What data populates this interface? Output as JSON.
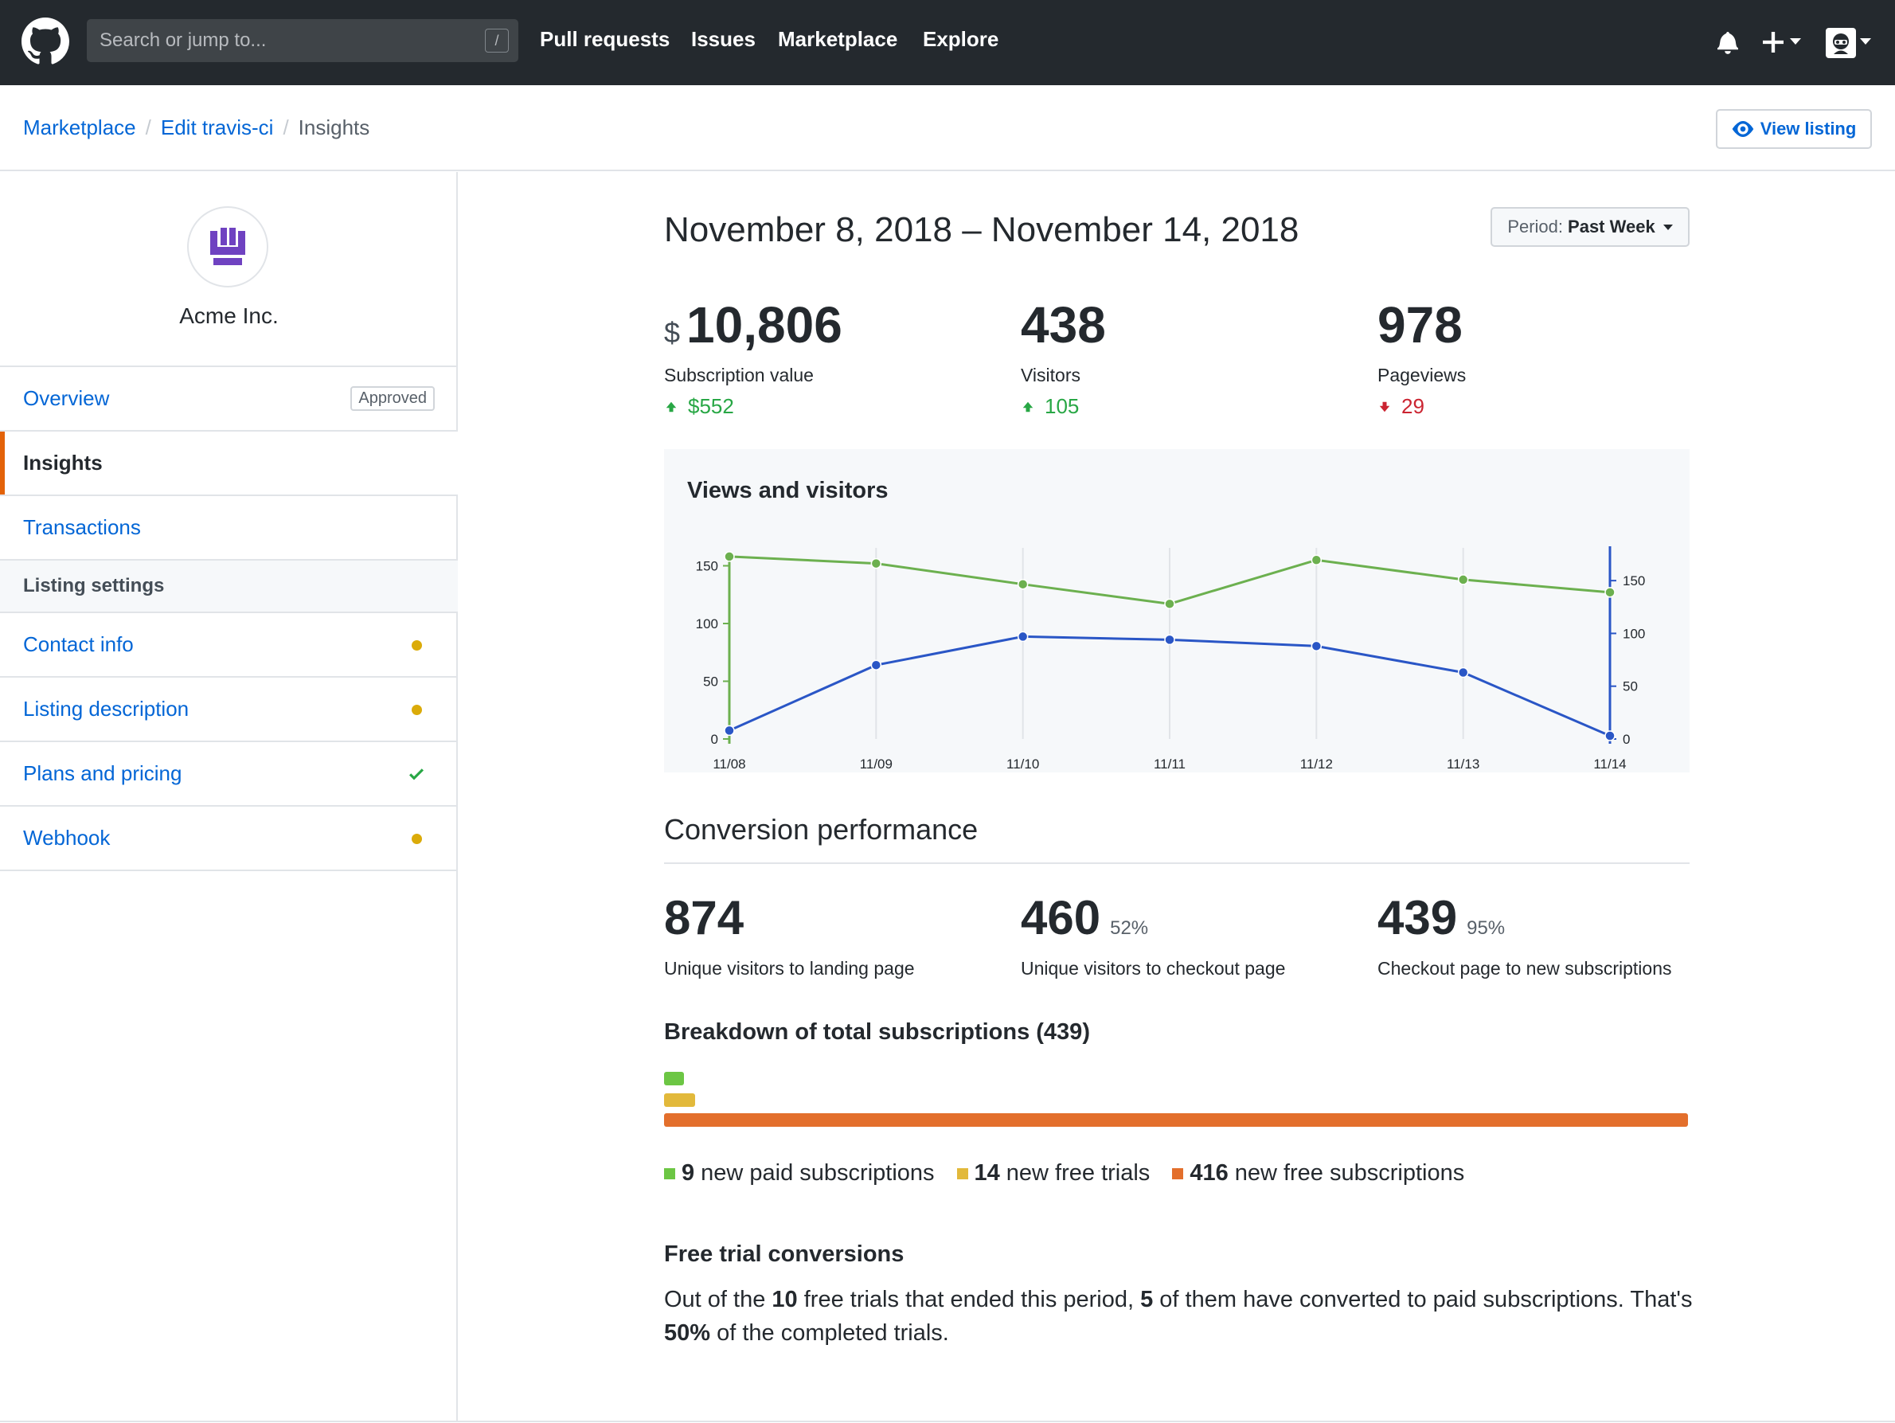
{
  "header": {
    "search_placeholder": "Search or jump to...",
    "search_shortcut": "/",
    "nav": [
      "Pull requests",
      "Issues",
      "Marketplace",
      "Explore"
    ]
  },
  "breadcrumb": {
    "items": [
      "Marketplace",
      "Edit travis-ci",
      "Insights"
    ],
    "view_listing": "View listing"
  },
  "sidebar": {
    "org_name": "Acme Inc.",
    "overview": "Overview",
    "overview_badge": "Approved",
    "insights": "Insights",
    "transactions": "Transactions",
    "section_label": "Listing settings",
    "contact_info": "Contact info",
    "listing_description": "Listing description",
    "plans_and_pricing": "Plans and pricing",
    "webhook": "Webhook"
  },
  "main": {
    "date_range": "November 8, 2018 – November 14, 2018",
    "period_label": "Period:",
    "period_value": "Past Week",
    "stats": [
      {
        "prefix": "$",
        "value": "10,806",
        "label": "Subscription value",
        "delta": "$552",
        "direction": "up"
      },
      {
        "prefix": "",
        "value": "438",
        "label": "Visitors",
        "delta": "105",
        "direction": "up"
      },
      {
        "prefix": "",
        "value": "978",
        "label": "Pageviews",
        "delta": "29",
        "direction": "down"
      }
    ],
    "conversion_title": "Conversion performance",
    "conversion": [
      {
        "value": "874",
        "pct": "",
        "label": "Unique visitors to landing page"
      },
      {
        "value": "460",
        "pct": "52%",
        "label": "Unique visitors to checkout page"
      },
      {
        "value": "439",
        "pct": "95%",
        "label": "Checkout page to new subscriptions"
      }
    ],
    "breakdown_title": "Breakdown of total subscriptions (439)",
    "breakdown": [
      {
        "count": "9",
        "label": "new paid subscriptions",
        "color": "#6cc644",
        "value": 9
      },
      {
        "count": "14",
        "label": "new free trials",
        "color": "#e2b93b",
        "value": 14
      },
      {
        "count": "416",
        "label": "new free subscriptions",
        "color": "#e36f2c",
        "value": 416
      }
    ],
    "free_trial_title": "Free trial conversions",
    "free_trial_text": {
      "t1": "Out of the ",
      "n1": "10",
      "t2": " free trials that ended this period, ",
      "n2": "5",
      "t3": " of them have converted to paid subscriptions. That's ",
      "n3": "50%",
      "t4": " of the completed trials."
    }
  },
  "chart_data": {
    "type": "line",
    "title": "Views and visitors",
    "categories": [
      "11/08",
      "11/09",
      "11/10",
      "11/11",
      "11/12",
      "11/13",
      "11/14"
    ],
    "series": [
      {
        "values": [
          158,
          152,
          134,
          117,
          155,
          138,
          127
        ],
        "color": "#6cb04f",
        "axis": "left"
      },
      {
        "values": [
          8,
          70,
          97,
          94,
          88,
          63,
          3
        ],
        "color": "#2a56c6",
        "axis": "right"
      }
    ],
    "y_left": {
      "ticks": [
        0,
        50,
        100,
        150
      ],
      "ylim": [
        0,
        160
      ]
    },
    "y_right": {
      "ticks": [
        0,
        50,
        100,
        150
      ],
      "ylim": [
        0,
        175
      ]
    },
    "grid": "vertical"
  },
  "colors": {
    "accent": "#0366d6",
    "header_bg": "#24292e",
    "active_marker": "#e36209",
    "up": "#28a745",
    "down": "#cb2431",
    "pending_dot": "#dbab09"
  }
}
